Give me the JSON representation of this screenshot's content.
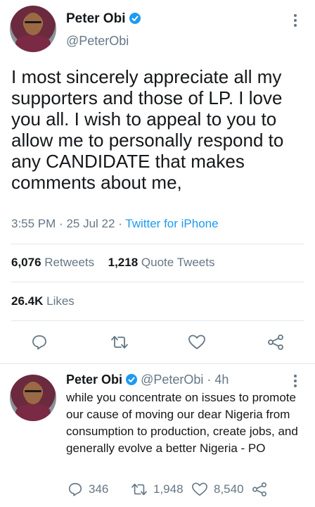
{
  "main_tweet": {
    "author_name": "Peter Obi",
    "handle": "@PeterObi",
    "text": "I most sincerely appreciate all my supporters and those of LP. I love you all. I wish to appeal to you to allow me to personally respond to any CANDIDATE that makes comments about me,",
    "time": "3:55 PM",
    "date": "25 Jul 22",
    "source": "Twitter for iPhone",
    "dot": "·",
    "retweets_count": "6,076",
    "retweets_label": "Retweets",
    "quote_count": "1,218",
    "quote_label": "Quote Tweets",
    "likes_count": "26.4K",
    "likes_label": "Likes"
  },
  "reply_tweet": {
    "author_name": "Peter Obi",
    "handle": "@PeterObi",
    "dot": "·",
    "age": "4h",
    "text": "while you concentrate on issues to promote our cause of moving our dear Nigeria from consumption to production, create jobs, and generally evolve a better Nigeria - PO",
    "replies": "346",
    "retweets": "1,948",
    "likes": "8,540"
  },
  "colors": {
    "accent": "#1d9bf0",
    "muted": "#657786",
    "divider": "#e1e8ed"
  },
  "icons": [
    "verified-badge-icon",
    "more-options-icon",
    "reply-icon",
    "retweet-icon",
    "like-icon",
    "share-icon"
  ]
}
